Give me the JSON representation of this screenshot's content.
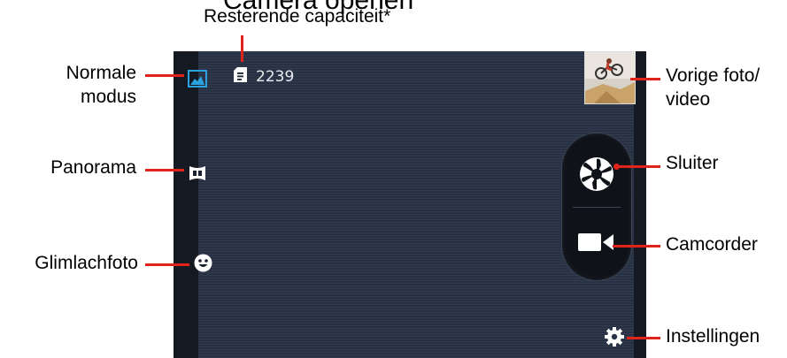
{
  "header": {
    "cropped_title": "Camera openen"
  },
  "screen": {
    "storage": {
      "icon": "sd-card-icon",
      "remaining_count": "2239"
    },
    "icons": {
      "normal_mode": "picture-icon",
      "panorama": "panorama-icon",
      "smile": "smile-icon",
      "shutter": "aperture-icon",
      "camcorder": "video-camera-icon",
      "settings": "gear-icon",
      "last_photo": "thumbnail-image"
    }
  },
  "callouts": {
    "remaining_capacity": "Resterende capaciteit*",
    "normal_mode_line1": "Normale",
    "normal_mode_line2": "modus",
    "panorama": "Panorama",
    "smile": "Glimlachfoto",
    "previous_line1": "Vorige foto/",
    "previous_line2": "video",
    "shutter": "Sluiter",
    "camcorder": "Camcorder",
    "settings": "Instellingen"
  },
  "colors": {
    "callout_line": "#e2231a",
    "screen_bg": "#2a3447",
    "active_icon": "#2aa3df"
  }
}
